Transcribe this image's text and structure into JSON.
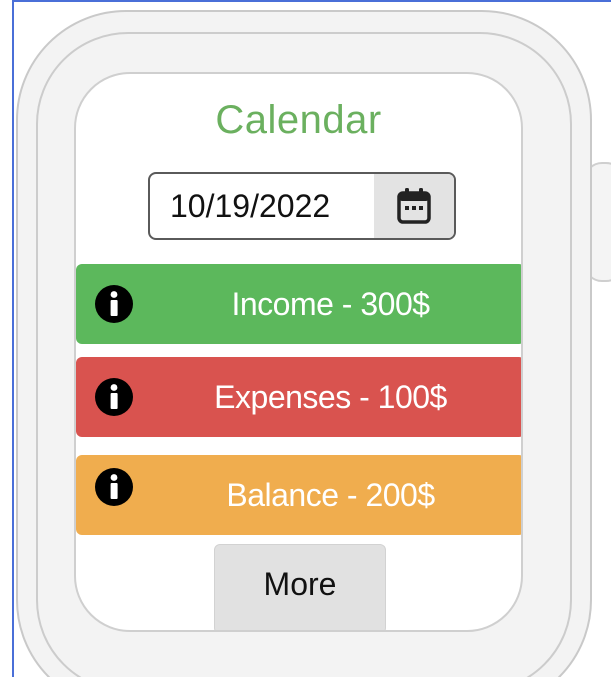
{
  "screen": {
    "title": "Calendar"
  },
  "date_picker": {
    "value": "10/19/2022",
    "icon": "calendar-icon"
  },
  "summary": [
    {
      "label": "Income - 300$",
      "color": "#5cb85c",
      "icon": "info-icon"
    },
    {
      "label": "Expenses - 100$",
      "color": "#d9534f",
      "icon": "info-icon"
    },
    {
      "label": "Balance - 200$",
      "color": "#f0ad4e",
      "icon": "info-icon"
    }
  ],
  "more_button": {
    "label": "More"
  },
  "colors": {
    "title": "#6bb05f",
    "income": "#5cb85c",
    "expenses": "#d9534f",
    "balance": "#f0ad4e",
    "frame": "#4a6fd8"
  }
}
